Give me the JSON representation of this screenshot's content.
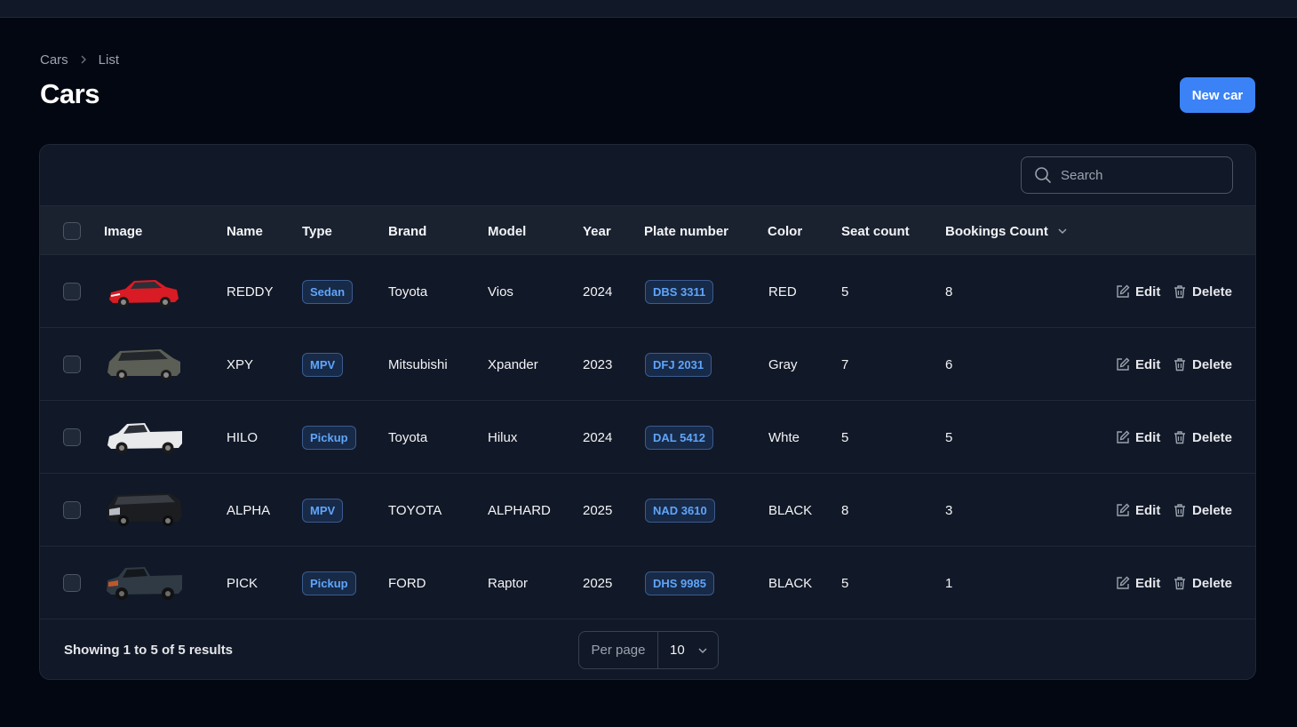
{
  "breadcrumb": {
    "items": [
      "Cars",
      "List"
    ]
  },
  "page": {
    "title": "Cars",
    "new_button": "New car"
  },
  "search": {
    "placeholder": "Search",
    "value": ""
  },
  "table": {
    "columns": [
      "Image",
      "Name",
      "Type",
      "Brand",
      "Model",
      "Year",
      "Plate number",
      "Color",
      "Seat count",
      "Bookings Count"
    ],
    "sort_column": "Bookings Count",
    "actions": {
      "edit": "Edit",
      "delete": "Delete"
    },
    "rows": [
      {
        "image": "red-sedan",
        "name": "REDDY",
        "type": "Sedan",
        "brand": "Toyota",
        "model": "Vios",
        "year": "2024",
        "plate": "DBS 3311",
        "color": "RED",
        "seats": "5",
        "bookings": "8"
      },
      {
        "image": "gray-mpv",
        "name": "XPY",
        "type": "MPV",
        "brand": "Mitsubishi",
        "model": "Xpander",
        "year": "2023",
        "plate": "DFJ 2031",
        "color": "Gray",
        "seats": "7",
        "bookings": "6"
      },
      {
        "image": "white-pickup",
        "name": "HILO",
        "type": "Pickup",
        "brand": "Toyota",
        "model": "Hilux",
        "year": "2024",
        "plate": "DAL 5412",
        "color": "Whte",
        "seats": "5",
        "bookings": "5"
      },
      {
        "image": "black-van",
        "name": "ALPHA",
        "type": "MPV",
        "brand": "TOYOTA",
        "model": "ALPHARD",
        "year": "2025",
        "plate": "NAD 3610",
        "color": "BLACK",
        "seats": "8",
        "bookings": "3"
      },
      {
        "image": "dark-pickup",
        "name": "PICK",
        "type": "Pickup",
        "brand": "FORD",
        "model": "Raptor",
        "year": "2025",
        "plate": "DHS 9985",
        "color": "BLACK",
        "seats": "5",
        "bookings": "1"
      }
    ]
  },
  "footer": {
    "summary": "Showing 1 to 5 of 5 results",
    "per_page_label": "Per page",
    "per_page_value": "10"
  },
  "colors": {
    "accent": "#3b82f6",
    "background": "#030712",
    "panel": "#111827",
    "badge_text": "#60a5fa"
  },
  "icons": {
    "search": "search-icon",
    "edit": "edit-icon",
    "delete": "trash-icon",
    "sort": "chevron-down-icon",
    "breadcrumb_sep": "chevron-right-icon"
  }
}
